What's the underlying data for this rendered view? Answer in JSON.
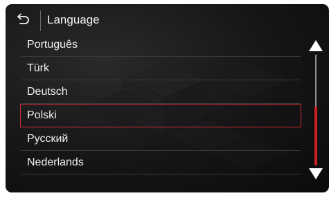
{
  "header": {
    "title": "Language",
    "back_icon": "back-arrow-icon"
  },
  "languages": [
    {
      "label": "Português",
      "selected": false
    },
    {
      "label": "Türk",
      "selected": false
    },
    {
      "label": "Deutsch",
      "selected": false
    },
    {
      "label": "Polski",
      "selected": true
    },
    {
      "label": "Русский",
      "selected": false
    },
    {
      "label": "Nederlands",
      "selected": false
    }
  ],
  "scrollbar": {
    "up_icon": "triangle-up-icon",
    "down_icon": "triangle-down-icon",
    "position": 0.7
  },
  "colors": {
    "accent": "#d02a2a",
    "text": "#f2f2f2",
    "background": "#151517"
  }
}
